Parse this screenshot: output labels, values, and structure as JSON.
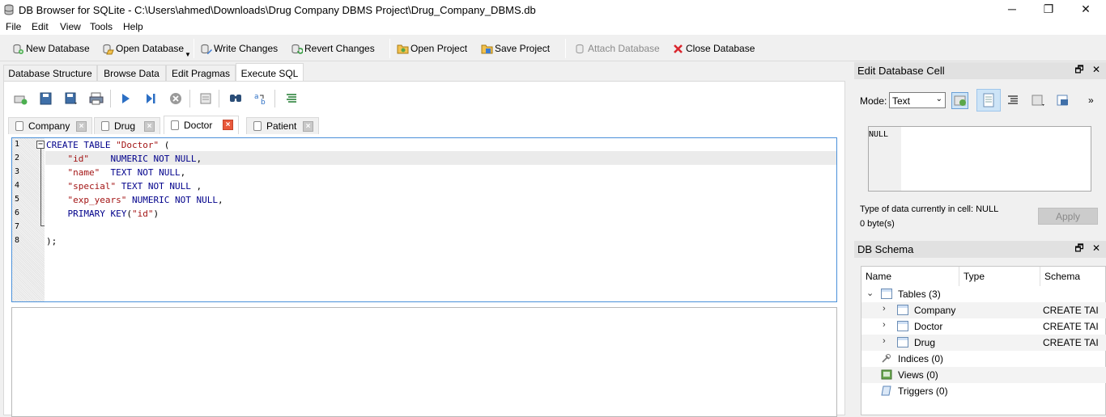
{
  "window": {
    "title": "DB Browser for SQLite - C:\\Users\\ahmed\\Downloads\\Drug Company DBMS Project\\Drug_Company_DBMS.db",
    "minimize": "─",
    "restore": "❐",
    "close": "✕"
  },
  "menu": [
    "File",
    "Edit",
    "View",
    "Tools",
    "Help"
  ],
  "toolbar": {
    "new_database": "New Database",
    "open_database": "Open Database",
    "write_changes": "Write Changes",
    "revert_changes": "Revert Changes",
    "open_project": "Open Project",
    "save_project": "Save Project",
    "attach_database": "Attach Database",
    "close_database": "Close Database"
  },
  "main_tabs": [
    "Database Structure",
    "Browse Data",
    "Edit Pragmas",
    "Execute SQL"
  ],
  "active_main_tab": "Execute SQL",
  "query_tabs": [
    "Company",
    "Drug",
    "Doctor",
    "Patient"
  ],
  "active_query_tab": "Doctor",
  "editor": {
    "line_numbers": [
      "1",
      "2",
      "3",
      "4",
      "5",
      "6",
      "7",
      "8"
    ],
    "current_line": 2
  },
  "edit_cell": {
    "title": "Edit Database Cell",
    "mode_label": "Mode:",
    "mode_value": "Text",
    "cell_value": "NULL",
    "type_info": "Type of data currently in cell: NULL",
    "size_info": "0 byte(s)",
    "apply": "Apply",
    "more": "»"
  },
  "schema": {
    "title": "DB Schema",
    "columns": [
      "Name",
      "Type",
      "Schema"
    ],
    "tables_label": "Tables (3)",
    "tables": [
      {
        "name": "Company",
        "schema": "CREATE TAI"
      },
      {
        "name": "Doctor",
        "schema": "CREATE TAI"
      },
      {
        "name": "Drug",
        "schema": "CREATE TAI"
      }
    ],
    "indices": "Indices (0)",
    "views": "Views (0)",
    "triggers": "Triggers (0)"
  },
  "dock_buttons": {
    "float": "🗗",
    "close": "✕"
  }
}
